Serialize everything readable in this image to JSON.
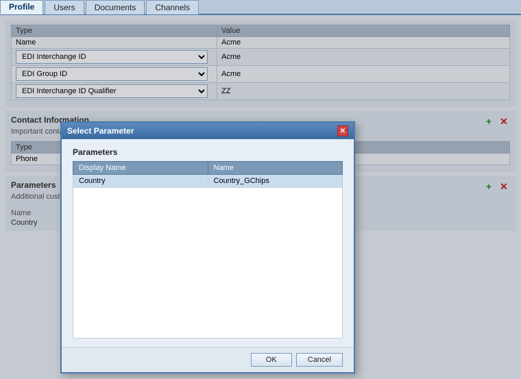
{
  "tabs": [
    {
      "label": "Profile",
      "active": true
    },
    {
      "label": "Users",
      "active": false
    },
    {
      "label": "Documents",
      "active": false
    },
    {
      "label": "Channels",
      "active": false
    }
  ],
  "fields_header": {
    "type_col": "Type",
    "value_col": "Value"
  },
  "fields": [
    {
      "type": "Name",
      "value": "Acme"
    },
    {
      "type": "EDI Interchange ID",
      "value": "Acme"
    },
    {
      "type": "EDI Group ID",
      "value": "Acme"
    },
    {
      "type": "EDI Interchange ID Qualifier",
      "value": "ZZ"
    }
  ],
  "contact_section": {
    "title": "Contact Information",
    "subtitle": "Important contact",
    "type_header": "Type",
    "type_value": "Phone"
  },
  "parameters_section": {
    "title": "Parameters",
    "subtitle": "Additional custom",
    "name_label": "Name",
    "name_value": "Country"
  },
  "dialog": {
    "title": "Select Parameter",
    "section_label": "Parameters",
    "col_display": "Display Name",
    "col_name": "Name",
    "row": {
      "display": "Country",
      "name": "Country_GChips"
    },
    "ok_label": "OK",
    "cancel_label": "Cancel"
  },
  "icons": {
    "add": "+",
    "remove": "✕",
    "close": "✕",
    "dropdown_arrow": "▼"
  }
}
